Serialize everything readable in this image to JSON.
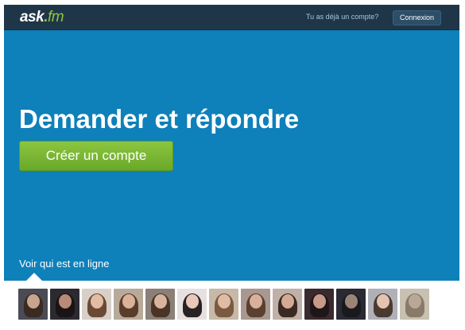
{
  "header": {
    "logo_main": "ask",
    "logo_dot": ".",
    "logo_tld": "fm",
    "already_account": "Tu as déjà un compte?",
    "login_label": "Connexion"
  },
  "hero": {
    "title": "Demander et répondre",
    "cta_label": "Créer un compte",
    "online_label": "Voir qui est en ligne"
  },
  "colors": {
    "topbar": "#1f3648",
    "hero": "#0e80ba",
    "cta": "#7cb832",
    "logo_accent": "#8ec63f"
  },
  "avatars": [
    {
      "bg": "#4a4b55",
      "skin": "#c9a48e",
      "hair": "#3a2a22"
    },
    {
      "bg": "#2a2a30",
      "skin": "#b98a78",
      "hair": "#1a1414"
    },
    {
      "bg": "#d8d0c8",
      "skin": "#e3bca4",
      "hair": "#6b4a35"
    },
    {
      "bg": "#b8aa9a",
      "skin": "#dab29a",
      "hair": "#5a3c2a"
    },
    {
      "bg": "#8a8078",
      "skin": "#d8b49e",
      "hair": "#4a3426"
    },
    {
      "bg": "#e6e0e0",
      "skin": "#e8c8b8",
      "hair": "#2a2222"
    },
    {
      "bg": "#c8b8a8",
      "skin": "#e0bca4",
      "hair": "#7a5a40"
    },
    {
      "bg": "#a89890",
      "skin": "#d8b09c",
      "hair": "#5a4030"
    },
    {
      "bg": "#c0b0a8",
      "skin": "#d4aa94",
      "hair": "#3a2a22"
    },
    {
      "bg": "#3a2a30",
      "skin": "#c89a88",
      "hair": "#1e1618"
    },
    {
      "bg": "#2a2a34",
      "skin": "#9a8478",
      "hair": "#1a1a1e"
    },
    {
      "bg": "#b0b0b8",
      "skin": "#e4c4b0",
      "hair": "#4a3a30"
    },
    {
      "bg": "#c8c0b0",
      "skin": "#b8a898",
      "hair": "#8a7a6a"
    }
  ]
}
